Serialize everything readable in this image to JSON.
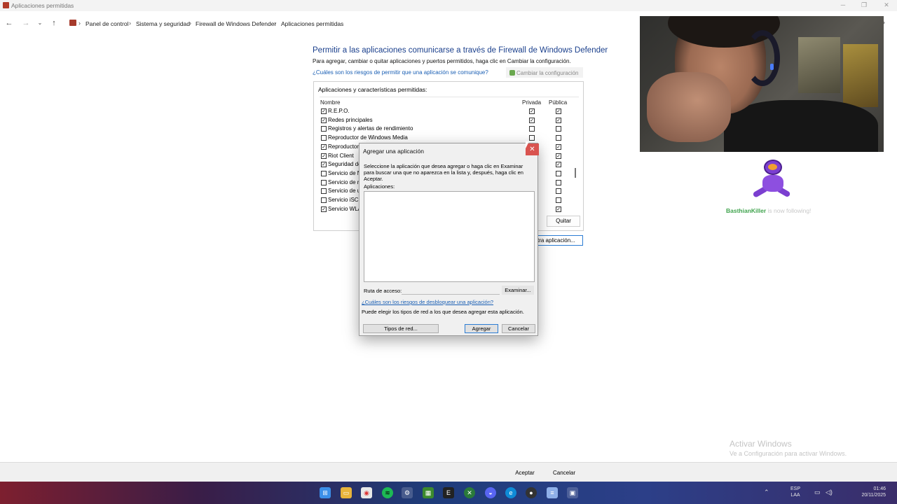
{
  "window": {
    "title": "Aplicaciones permitidas"
  },
  "breadcrumb": [
    "Panel de control",
    "Sistema y seguridad",
    "Firewall de Windows Defender",
    "Aplicaciones permitidas"
  ],
  "main": {
    "title": "Permitir a las aplicaciones comunicarse a través de Firewall de Windows Defender",
    "description": "Para agregar, cambiar o quitar aplicaciones y puertos permitidos, haga clic en Cambiar la configuración.",
    "risk_link": "¿Cuáles son los riesgos de permitir que una aplicación se comunique?",
    "change_settings": "Cambiar la configuración",
    "box_label": "Aplicaciones y características permitidas:",
    "columns": {
      "name": "Nombre",
      "private": "Privada",
      "public": "Pública"
    },
    "rows": [
      {
        "name": "R.E.P.O.",
        "enabled": true,
        "private": true,
        "public": true
      },
      {
        "name": "Redes principales",
        "enabled": true,
        "private": true,
        "public": true
      },
      {
        "name": "Registros y alertas de rendimiento",
        "enabled": false,
        "private": false,
        "public": false
      },
      {
        "name": "Reproductor de Windows Media",
        "enabled": false,
        "private": false,
        "public": false
      },
      {
        "name": "Reproductor",
        "enabled": true,
        "private": true,
        "public": true
      },
      {
        "name": "Riot Client",
        "enabled": true,
        "private": true,
        "public": true
      },
      {
        "name": "Seguridad de",
        "enabled": true,
        "private": true,
        "public": true
      },
      {
        "name": "Servicio de N",
        "enabled": false,
        "private": false,
        "public": false
      },
      {
        "name": "Servicio de r",
        "enabled": false,
        "private": false,
        "public": false
      },
      {
        "name": "Servicio de u",
        "enabled": false,
        "private": false,
        "public": false
      },
      {
        "name": "Servicio iSCS",
        "enabled": false,
        "private": false,
        "public": false
      },
      {
        "name": "Servicio WLA",
        "enabled": true,
        "private": true,
        "public": true
      }
    ],
    "remove_button": "Quitar",
    "other_app_button": "tra aplicación..."
  },
  "dialog": {
    "title": "Agregar una aplicación",
    "close": "✕",
    "description": "Seleccione la aplicación que desea agregar o haga clic en Examinar para buscar una que no aparezca en la lista y, después, haga clic en Aceptar.",
    "apps_label": "Aplicaciones:",
    "path_label": "Ruta de acceso:",
    "browse_button": "Examinar...",
    "risk_link": "¿Cuáles son los riesgos de desbloquear una aplicación?",
    "hint": "Puede elegir los tipos de red a los que desea agregar esta aplicación.",
    "network_types_button": "Tipos de red...",
    "add_button": "Agregar",
    "cancel_button": "Cancelar"
  },
  "overlay": {
    "follower_name": "BasthianKiller",
    "follower_message": "is now following!"
  },
  "watermark": {
    "title": "Activar Windows",
    "subtitle": "Ve a Configuración para activar Windows."
  },
  "footer": {
    "accept": "Aceptar",
    "cancel": "Cancelar"
  },
  "taskbar": {
    "lang_1": "ESP",
    "lang_2": "LAA",
    "time": "01:46",
    "date": "20/11/2025"
  },
  "colors": {
    "link": "#1a5fb4",
    "title": "#1a3f8c",
    "accent": "#2b7cd3",
    "close": "#d9534f"
  }
}
